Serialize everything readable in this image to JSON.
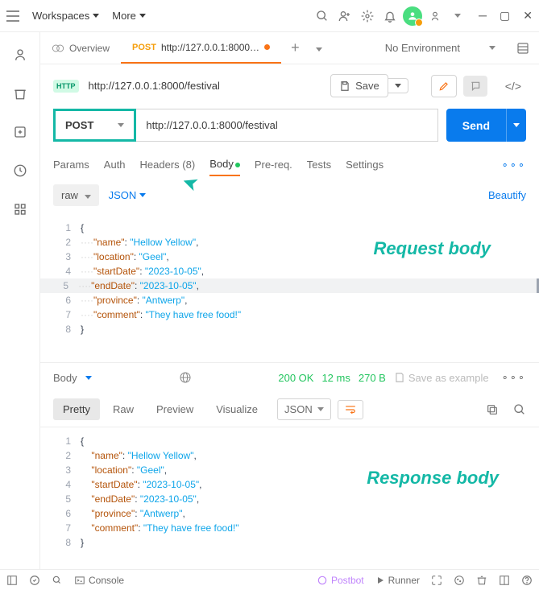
{
  "titlebar": {
    "workspaces": "Workspaces",
    "more": "More"
  },
  "tabs": {
    "overview": "Overview",
    "active_method": "POST",
    "active_url": "http://127.0.0.1:8000…",
    "env": "No Environment"
  },
  "urlbar": {
    "url": "http://127.0.0.1:8000/festival",
    "save": "Save"
  },
  "request": {
    "method": "POST",
    "url_value": "http://127.0.0.1:8000/festival",
    "send": "Send"
  },
  "subtabs": {
    "params": "Params",
    "auth": "Auth",
    "headers": "Headers (8)",
    "body": "Body",
    "prereq": "Pre-req.",
    "tests": "Tests",
    "settings": "Settings"
  },
  "bodyopts": {
    "raw": "raw",
    "json": "JSON",
    "beautify": "Beautify"
  },
  "request_body": {
    "name_key": "\"name\"",
    "name_val": "\"Hellow Yellow\"",
    "location_key": "\"location\"",
    "location_val": "\"Geel\"",
    "startDate_key": "\"startDate\"",
    "startDate_val": "\"2023-10-05\"",
    "endDate_key": "\"endDate\"",
    "endDate_val": "\"2023-10-05\"",
    "province_key": "\"province\"",
    "province_val": "\"Antwerp\"",
    "comment_key": "\"comment\"",
    "comment_val": "\"They have free food!\""
  },
  "annotations": {
    "req": "Request body",
    "resp": "Response body"
  },
  "resp_header": {
    "body": "Body",
    "status": "200 OK",
    "time": "12 ms",
    "size": "270 B",
    "save_ex": "Save as example"
  },
  "resp_opts": {
    "pretty": "Pretty",
    "raw": "Raw",
    "preview": "Preview",
    "visualize": "Visualize",
    "json": "JSON"
  },
  "response_body": {
    "name_key": "\"name\"",
    "name_val": "\"Hellow Yellow\"",
    "location_key": "\"location\"",
    "location_val": "\"Geel\"",
    "startDate_key": "\"startDate\"",
    "startDate_val": "\"2023-10-05\"",
    "endDate_key": "\"endDate\"",
    "endDate_val": "\"2023-10-05\"",
    "province_key": "\"province\"",
    "province_val": "\"Antwerp\"",
    "comment_key": "\"comment\"",
    "comment_val": "\"They have free food!\""
  },
  "footer": {
    "console": "Console",
    "postbot": "Postbot",
    "runner": "Runner"
  }
}
